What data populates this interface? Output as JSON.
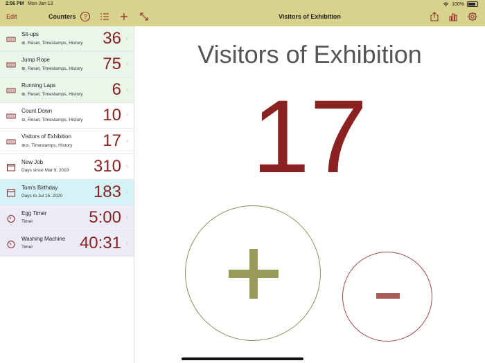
{
  "status": {
    "time": "2:56 PM",
    "date": "Mon Jan 13",
    "battery": "100%"
  },
  "nav": {
    "edit_label": "Edit",
    "left_title": "Counters",
    "main_title": "Visitors of Exhibition"
  },
  "counters": [
    {
      "title": "Sit-ups",
      "sub": "⊕, Reset, Timestamps, History",
      "value": "36",
      "icon": "counter-icon",
      "bg": "green"
    },
    {
      "title": "Jump Rope",
      "sub": "⊕, Reset, Timestamps, History",
      "value": "75",
      "icon": "counter-icon",
      "bg": "green"
    },
    {
      "title": "Running Laps",
      "sub": "⊕, Reset, Timestamps, History",
      "value": "6",
      "icon": "counter-icon",
      "bg": "green"
    },
    {
      "title": "Count Down",
      "sub": "⊖, Reset, Timestamps, History",
      "value": "10",
      "icon": "counter-icon",
      "bg": "white"
    },
    {
      "title": "Visitors of Exhibition",
      "sub": "⊕⊖, Timestamps, History",
      "value": "17",
      "icon": "counter-icon",
      "bg": "white"
    },
    {
      "title": "New Job",
      "sub": "Days since Mar 9, 2019",
      "value": "310",
      "icon": "calendar-icon",
      "bg": "white"
    },
    {
      "title": "Tom's Birthday",
      "sub": "Days to Jul 15, 2020",
      "value": "183",
      "icon": "calendar-icon",
      "bg": "cyan"
    },
    {
      "title": "Egg Timer",
      "sub": "Timer",
      "value": "5:00",
      "icon": "timer-icon",
      "bg": "lav"
    },
    {
      "title": "Washing Machine",
      "sub": "Timer",
      "value": "40:31",
      "icon": "timer-icon",
      "bg": "lav"
    }
  ],
  "main": {
    "title": "Visitors of Exhibition",
    "count": "17"
  },
  "colors": {
    "accent": "#8b2222",
    "navbar": "#d8d38c",
    "plus": "#999b5a",
    "minus": "#a85a58"
  }
}
